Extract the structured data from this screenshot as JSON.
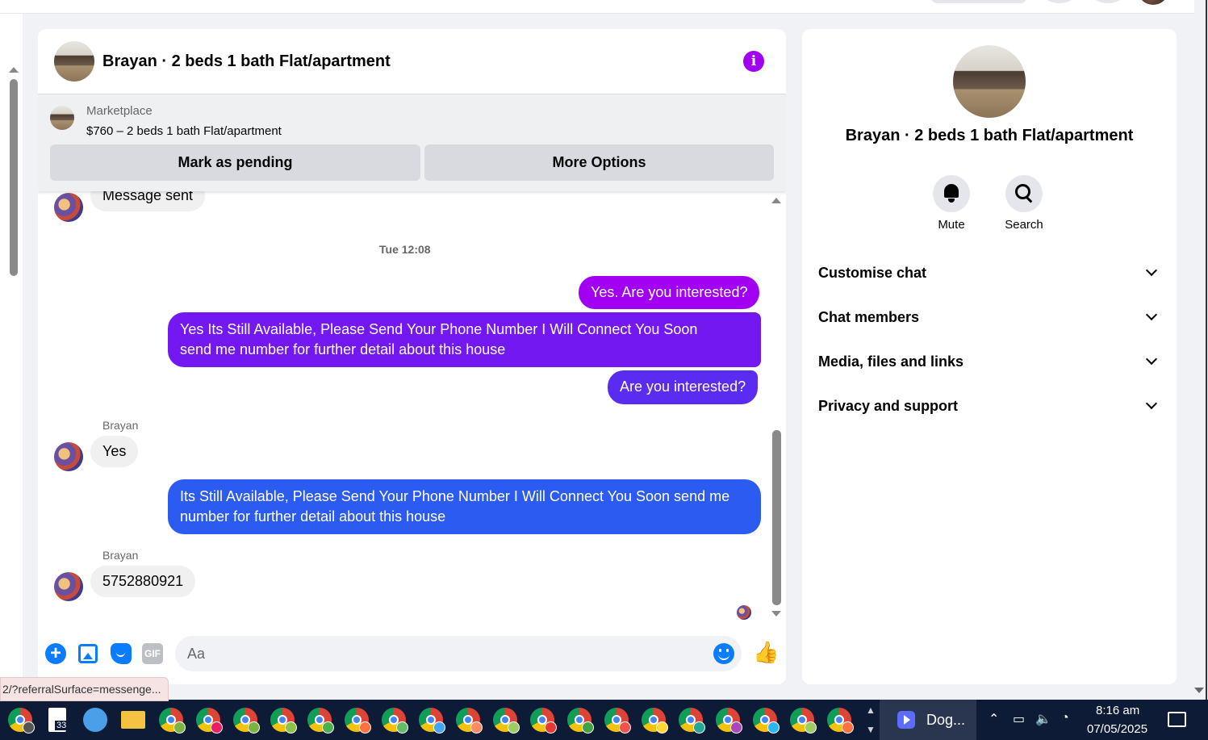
{
  "header": {
    "title": "Brayan · 2 beds 1 bath Flat/apartment"
  },
  "marketplace": {
    "label": "Marketplace",
    "listing": "$760 – 2 beds 1 bath Flat/apartment",
    "mark_pending_label": "Mark as pending",
    "more_options_label": "More Options"
  },
  "messages": {
    "first_partial": "Message sent",
    "timestamp": "Tue 12:08",
    "out1": "Yes. Are you interested?",
    "out2_line1": "Yes Its Still Available, Please Send Your Phone Number I Will Connect You Soon",
    "out2_line2": "send me number for further detail about this house",
    "out3": "Are you interested?",
    "sender1": "Brayan",
    "in1": "Yes",
    "out4_line1": "Its Still Available, Please Send Your Phone Number I Will Connect You Soon  send me",
    "out4_line2": "number for further detail about this house",
    "sender2": "Brayan",
    "in2": "5752880921"
  },
  "composer": {
    "placeholder": "Aa",
    "gif_label": "GIF"
  },
  "status_url": "2/?referralSurface=messenge...",
  "info_panel": {
    "name": "Brayan · 2 beds 1 bath Flat/apartment",
    "mute_label": "Mute",
    "search_label": "Search",
    "sections": [
      "Customise chat",
      "Chat members",
      "Media, files and links",
      "Privacy and support"
    ]
  },
  "taskbar": {
    "file_badge": "33",
    "active_app_label": "Dog...",
    "time": "8:16 am",
    "date": "07/05/2025"
  },
  "colors": {
    "bubble_purple": "#a100f2",
    "bubble_gradient_mid": "#7318f0",
    "bubble_blue": "#2b5bf0",
    "accent_blue": "#0a7cff",
    "taskbar_bg": "#0e1b36"
  },
  "icons": [
    "info-icon",
    "plus-icon",
    "photo-icon",
    "sticker-icon",
    "gif-icon",
    "emoji-icon",
    "like-icon",
    "bell-icon",
    "search-icon",
    "chevron-down-icon",
    "chrome-icon",
    "file-icon",
    "folder-icon",
    "snip-icon"
  ]
}
